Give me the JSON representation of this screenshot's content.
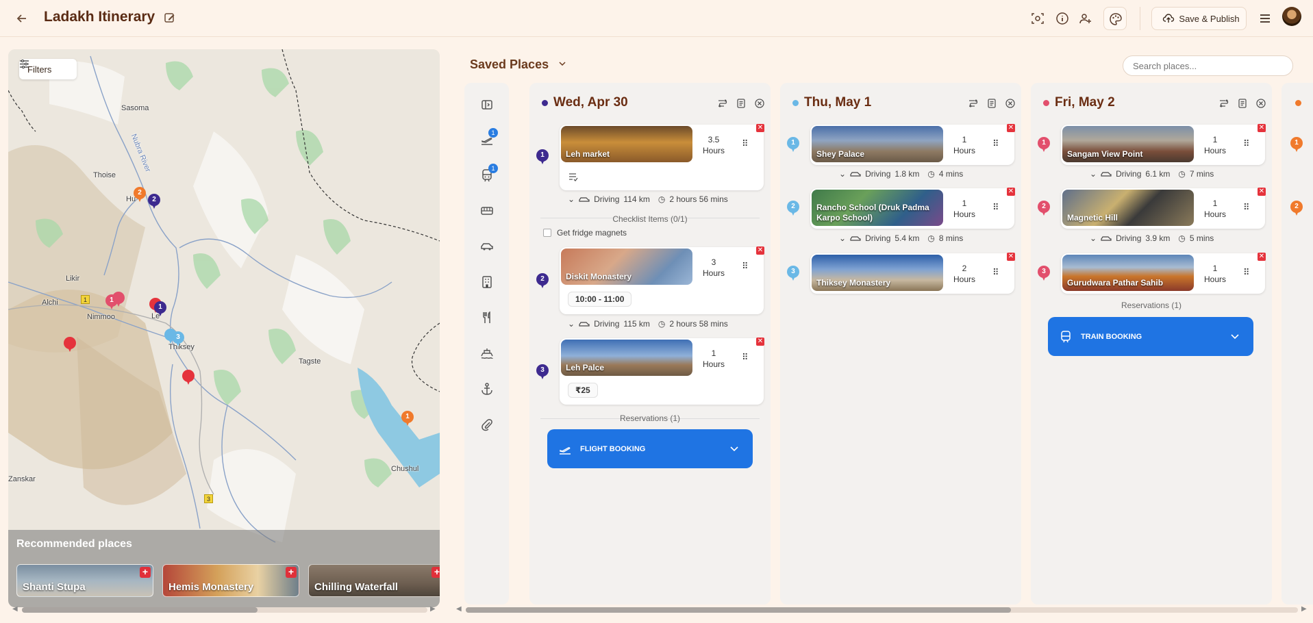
{
  "header": {
    "title": "Ladakh Itinerary",
    "save_label": "Save & Publish"
  },
  "map": {
    "filters_label": "Filters",
    "labels": [
      "Sasoma",
      "Thoise",
      "Hu",
      "Likir",
      "Alchi",
      "Nimmoo",
      "Le",
      "Thiksey",
      "Tagste",
      "Zanskar",
      "Chushul",
      "Nubra River"
    ],
    "road_shields": [
      "1",
      "3"
    ],
    "recommended": {
      "title": "Recommended places",
      "items": [
        "Shanti Stupa",
        "Hemis Monastery",
        "Chilling Waterfall"
      ]
    }
  },
  "saved": {
    "title": "Saved Places",
    "search_placeholder": "Search places..."
  },
  "rail": {
    "flight_count": "1",
    "train_count": "1"
  },
  "colors": {
    "accent_blue": "#1f74e3",
    "day1": "#3d2a8f",
    "day2": "#6ab8e6",
    "day3": "#e24f6c",
    "day4": "#f07a2c",
    "delete_red": "#e5333c"
  },
  "days": [
    {
      "title": "Wed, Apr 30",
      "places": [
        {
          "num": "1",
          "name": "Leh market",
          "duration": "3.5",
          "unit": "Hours"
        },
        {
          "num": "2",
          "name": "Diskit Monastery",
          "duration": "3",
          "unit": "Hours",
          "time": "10:00 - 11:00"
        },
        {
          "num": "3",
          "name": "Leh Palce",
          "duration": "1",
          "unit": "Hours",
          "price": "₹25"
        }
      ],
      "drives": [
        {
          "mode": "Driving",
          "dist": "114 km",
          "time": "2 hours 56 mins"
        },
        {
          "mode": "Driving",
          "dist": "115 km",
          "time": "2 hours 58 mins"
        }
      ],
      "checklist_title": "Checklist Items (0/1)",
      "checklist_item": "Get fridge magnets",
      "reservations": "Reservations (1)",
      "booking": "FLIGHT BOOKING"
    },
    {
      "title": "Thu, May 1",
      "places": [
        {
          "num": "1",
          "name": "Shey Palace",
          "duration": "1",
          "unit": "Hours"
        },
        {
          "num": "2",
          "name": "Rancho School (Druk Padma Karpo School)",
          "duration": "1",
          "unit": "Hours"
        },
        {
          "num": "3",
          "name": "Thiksey Monastery",
          "duration": "2",
          "unit": "Hours"
        }
      ],
      "drives": [
        {
          "mode": "Driving",
          "dist": "1.8 km",
          "time": "4 mins"
        },
        {
          "mode": "Driving",
          "dist": "5.4 km",
          "time": "8 mins"
        }
      ]
    },
    {
      "title": "Fri, May 2",
      "places": [
        {
          "num": "1",
          "name": "Sangam View Point",
          "duration": "1",
          "unit": "Hours"
        },
        {
          "num": "2",
          "name": "Magnetic Hill",
          "duration": "1",
          "unit": "Hours"
        },
        {
          "num": "3",
          "name": "Gurudwara Pathar Sahib",
          "duration": "1",
          "unit": "Hours"
        }
      ],
      "drives": [
        {
          "mode": "Driving",
          "dist": "6.1 km",
          "time": "7 mins"
        },
        {
          "mode": "Driving",
          "dist": "3.9 km",
          "time": "5 mins"
        }
      ],
      "reservations": "Reservations (1)",
      "booking": "TRAIN BOOKING"
    },
    {
      "places": [
        {
          "num": "1"
        },
        {
          "num": "2"
        }
      ]
    }
  ]
}
